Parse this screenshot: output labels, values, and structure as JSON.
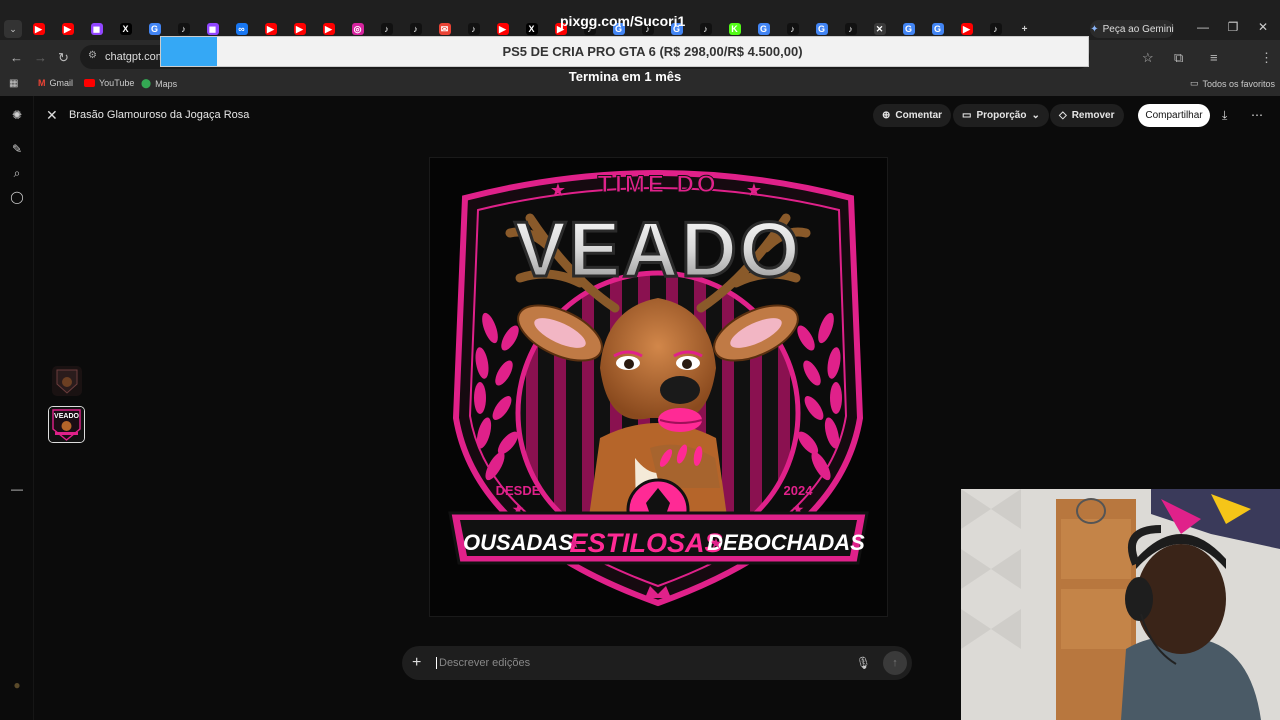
{
  "browser": {
    "overlay_title": "pixgg.com/Sucori1",
    "gemini_label": "Peça ao Gemini",
    "tab_icons": [
      "youtube",
      "youtube",
      "twitch",
      "x",
      "google",
      "tiktok",
      "twitch",
      "meta",
      "youtube",
      "youtube",
      "youtube",
      "instagram",
      "tiktok",
      "tiktok",
      "gmail",
      "tiktok",
      "youtube",
      "x",
      "youtube",
      "tiktok",
      "google",
      "tiktok",
      "google",
      "tiktok",
      "kick",
      "google",
      "tiktok",
      "google",
      "tiktok",
      "close",
      "google",
      "google",
      "youtube",
      "tiktok"
    ],
    "url": "chatgpt.com/",
    "banner_text": "PS5 DE CRIA PRO GTA 6 (R$ 298,00/R$ 4.500,00)",
    "promo_text": "Termina em 1 mês",
    "bookmarks": [
      "Gmail",
      "YouTube",
      "Maps"
    ],
    "favorites_label": "Todos os favoritos"
  },
  "editor": {
    "title": "Brasão Glamouroso da Jogaça Rosa",
    "comment_label": "Comentar",
    "ratio_label": "Proporção",
    "remove_label": "Remover",
    "share_label": "Compartilhar",
    "composer_placeholder": "Descrever edições"
  },
  "artwork": {
    "top_text": "TIME DO",
    "main_text": "VEADO",
    "since_label": "DESDE",
    "year": "2024",
    "ribbon": [
      "OUSADAS",
      "ESTILOSAS",
      "DEBOCHADAS"
    ],
    "thumb_text": "VEADO",
    "colors": {
      "pink": "#e0218a",
      "dark": "#111111",
      "deer": "#b5652a"
    }
  }
}
